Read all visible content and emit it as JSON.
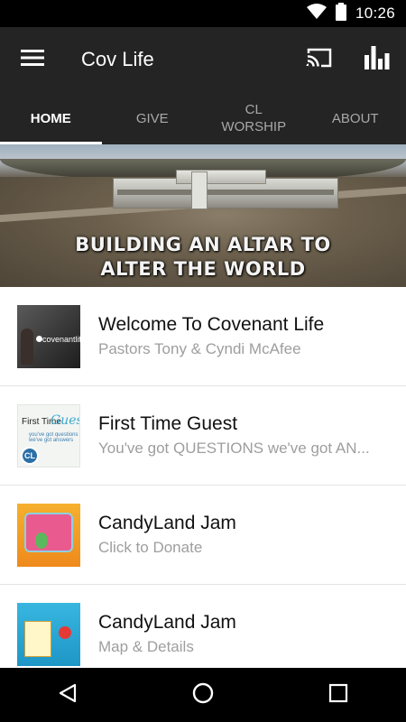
{
  "status_bar": {
    "time": "10:26",
    "icons": [
      "wifi-icon",
      "battery-icon"
    ]
  },
  "app_bar": {
    "title": "Cov Life",
    "icons": [
      "menu-icon",
      "cast-icon",
      "bar-chart-icon"
    ]
  },
  "tabs": [
    {
      "label": "HOME",
      "active": true
    },
    {
      "label": "GIVE",
      "active": false
    },
    {
      "label": "CL\nWORSHIP",
      "active": false
    },
    {
      "label": "ABOUT",
      "active": false
    }
  ],
  "banner": {
    "line1": "BUILDING AN ALTAR TO",
    "line2": "ALTER THE WORLD"
  },
  "list_items": [
    {
      "title": "Welcome To Covenant Life",
      "subtitle": "Pastors Tony & Cyndi McAfee",
      "thumb_text": "covenantlife"
    },
    {
      "title": "First Time Guest",
      "subtitle": "You've got QUESTIONS we've got AN...",
      "thumb_text_1": "First Time",
      "thumb_text_2": "Guest",
      "thumb_text_3": "you've got questions we've got answers",
      "thumb_badge": "CL"
    },
    {
      "title": "CandyLand Jam",
      "subtitle": "Click to Donate"
    },
    {
      "title": "CandyLand Jam",
      "subtitle": "Map & Details"
    }
  ],
  "nav_bar": {
    "icons": [
      "back-icon",
      "home-icon",
      "recents-icon"
    ]
  },
  "colors": {
    "status_bar": "#000000",
    "app_bar": "#242424",
    "tab_active": "#ffffff",
    "tab_inactive": "#a8a8a8",
    "subtitle": "#9e9e9e"
  }
}
